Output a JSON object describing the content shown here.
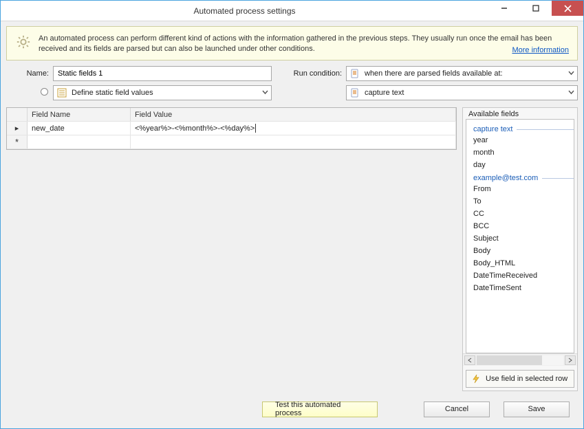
{
  "window": {
    "title": "Automated process settings"
  },
  "info": {
    "text": "An automated process can perform different kind of actions with the information gathered in the previous steps. They usually run once the email has been received and its fields are parsed but can also be launched under other conditions.",
    "link": "More information"
  },
  "labels": {
    "name": "Name:",
    "run_condition": "Run condition:"
  },
  "values": {
    "name": "Static fields 1",
    "action": "Define static field values",
    "run_condition": "when there are parsed fields available at:",
    "run_condition_detail": "capture text"
  },
  "grid": {
    "headers": {
      "name": "Field Name",
      "value": "Field Value"
    },
    "rows": [
      {
        "name": "new_date",
        "value": "<%year%>-<%month%>-<%day%>"
      }
    ]
  },
  "side": {
    "title": "Available fields",
    "groups": [
      {
        "label": "capture text",
        "items": [
          "year",
          "month",
          "day"
        ]
      },
      {
        "label": "example@test.com",
        "items": [
          "From",
          "To",
          "CC",
          "BCC",
          "Subject",
          "Body",
          "Body_HTML",
          "DateTimeReceived",
          "DateTimeSent"
        ]
      }
    ],
    "button": "Use field in selected row"
  },
  "footer": {
    "test": "Test this automated process",
    "cancel": "Cancel",
    "save": "Save"
  }
}
